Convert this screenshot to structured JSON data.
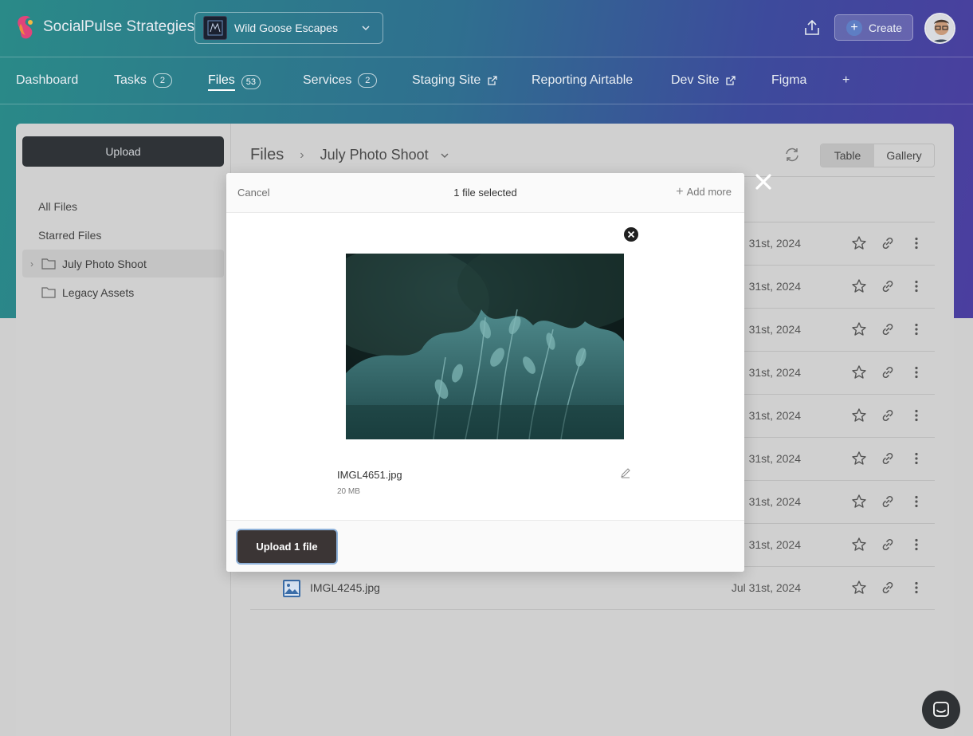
{
  "brand": {
    "name": "SocialPulse Strategies"
  },
  "project": {
    "name": "Wild Goose Escapes"
  },
  "header": {
    "create_label": "Create"
  },
  "nav": {
    "items": [
      {
        "label": "Dashboard",
        "badge": ""
      },
      {
        "label": "Tasks",
        "badge": "2"
      },
      {
        "label": "Files",
        "badge": "53"
      },
      {
        "label": "Services",
        "badge": "2"
      },
      {
        "label": "Staging Site",
        "badge": ""
      },
      {
        "label": "Reporting Airtable",
        "badge": ""
      },
      {
        "label": "Dev Site",
        "badge": ""
      },
      {
        "label": "Figma",
        "badge": ""
      },
      {
        "label": "+",
        "badge": ""
      }
    ],
    "active": "Files"
  },
  "sidebar": {
    "upload_label": "Upload",
    "links": [
      "All Files",
      "Starred Files"
    ],
    "folders": [
      "July Photo Shoot",
      "Legacy Assets"
    ]
  },
  "files": {
    "root": "Files",
    "current_folder": "July Photo Shoot",
    "view_table": "Table",
    "view_gallery": "Gallery",
    "rows": [
      {
        "name": "",
        "date": "31st, 2024"
      },
      {
        "name": "",
        "date": "31st, 2024"
      },
      {
        "name": "",
        "date": "31st, 2024"
      },
      {
        "name": "",
        "date": "31st, 2024"
      },
      {
        "name": "",
        "date": "31st, 2024"
      },
      {
        "name": "",
        "date": "31st, 2024"
      },
      {
        "name": "",
        "date": "31st, 2024"
      },
      {
        "name": "",
        "date": "31st, 2024"
      },
      {
        "name": "IMGL4245.jpg",
        "date": "Jul 31st, 2024"
      }
    ]
  },
  "modal": {
    "cancel_label": "Cancel",
    "title": "1 file selected",
    "add_more_label": "Add more",
    "file_name": "IMGL4651.jpg",
    "file_size": "20 MB",
    "upload_button_label": "Upload 1 file"
  },
  "colors": {
    "accent_dark": "#3b3535",
    "hero_start": "#2a8a88",
    "hero_end": "#4b3e9f"
  }
}
